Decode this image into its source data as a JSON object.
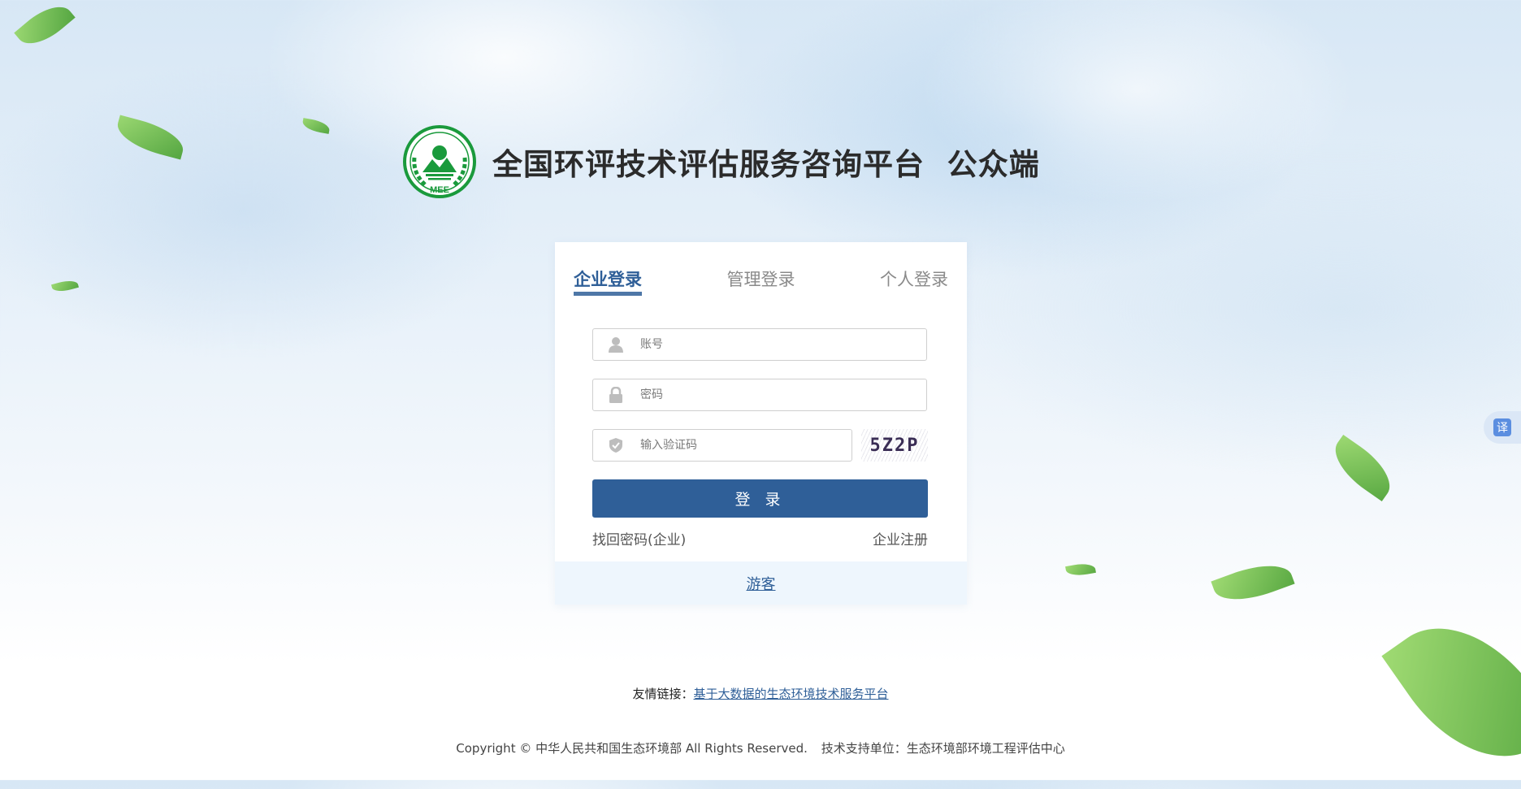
{
  "header": {
    "logo_text": "MEE",
    "title": "全国环评技术评估服务咨询平台  公众端"
  },
  "login": {
    "tabs": [
      {
        "label": "企业登录",
        "active": true
      },
      {
        "label": "管理登录",
        "active": false
      },
      {
        "label": "个人登录",
        "active": false
      }
    ],
    "account_placeholder": "账号",
    "password_placeholder": "密码",
    "captcha_placeholder": "输入验证码",
    "captcha_text": "5Z2P",
    "submit_label": "登 录",
    "forgot_password": "找回密码(企业)",
    "register": "企业注册",
    "guest": "游客"
  },
  "footer": {
    "friend_links_label": "友情链接：",
    "friend_link": "基于大数据的生态环境技术服务平台",
    "copyright": "Copyright © 中华人民共和国生态环境部 All Rights Reserved.",
    "support": "技术支持单位：生态环境部环境工程评估中心"
  },
  "translate": {
    "label": "译"
  },
  "colors": {
    "primary": "#2f5f98",
    "logo_green": "#1a9a3c",
    "guest_bar": "#eef6fd"
  }
}
